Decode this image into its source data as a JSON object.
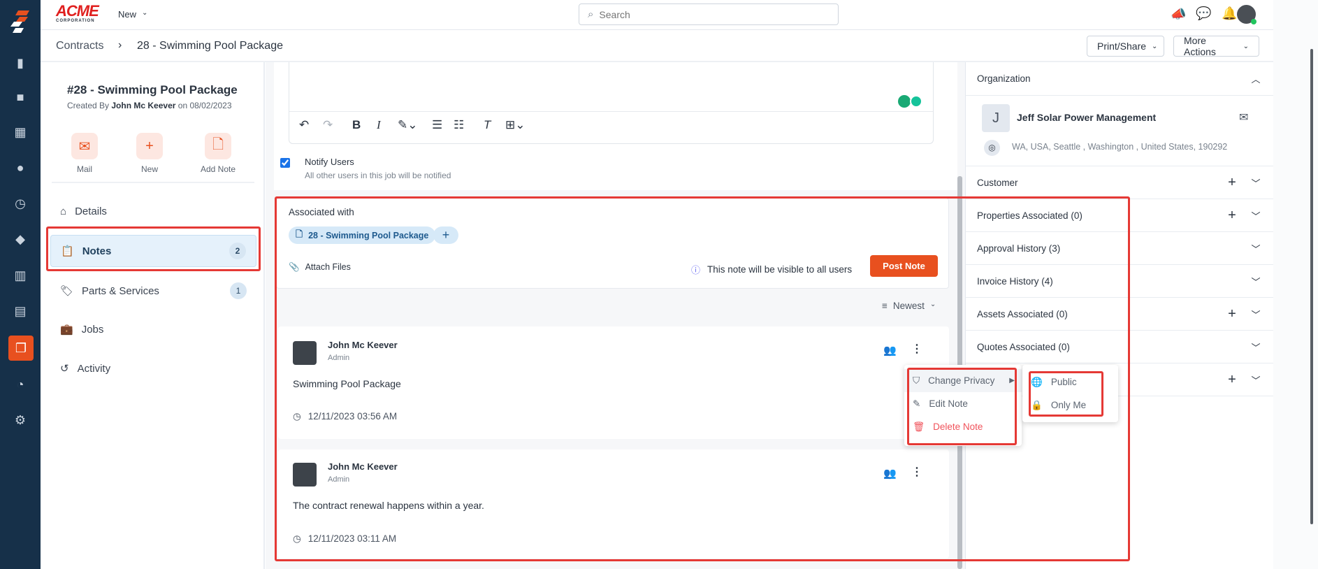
{
  "header": {
    "brand": "ACME",
    "brand_sub": "CORPORATION",
    "new_label": "New",
    "search_placeholder": "Search"
  },
  "breadcrumb": {
    "root": "Contracts",
    "current": "28 - Swimming Pool Package"
  },
  "actions": {
    "print_share": "Print/Share",
    "more_actions": "More Actions"
  },
  "record": {
    "title": "#28 - Swimming Pool Package",
    "created_prefix": "Created By",
    "created_by": "John Mc Keever",
    "created_on": "on 08/02/2023"
  },
  "quick_actions": [
    {
      "label": "Mail"
    },
    {
      "label": "New"
    },
    {
      "label": "Add Note"
    }
  ],
  "nav": [
    {
      "label": "Details"
    },
    {
      "label": "Notes",
      "count": "2"
    },
    {
      "label": "Parts & Services",
      "count": "1"
    },
    {
      "label": "Jobs"
    },
    {
      "label": "Activity"
    }
  ],
  "editor": {
    "notify_label": "Notify Users",
    "notify_hint": "All other users in this job will be notified",
    "notify_checked": true
  },
  "composer": {
    "associated_label": "Associated with",
    "chip": "28 - Swimming Pool Package",
    "attach": "Attach Files",
    "visibility": "This note will be visible to all users",
    "post": "Post Note"
  },
  "sort": {
    "label": "Newest"
  },
  "notes": [
    {
      "author": "John Mc Keever",
      "role": "Admin",
      "text": "Swimming Pool Package",
      "time": "12/11/2023 03:56 AM"
    },
    {
      "author": "John Mc Keever",
      "role": "Admin",
      "text": "The contract renewal happens within a year.",
      "time": "12/11/2023 03:11 AM"
    }
  ],
  "menu": {
    "change_privacy": "Change Privacy",
    "edit": "Edit Note",
    "delete": "Delete Note"
  },
  "submenu": {
    "public": "Public",
    "only_me": "Only Me"
  },
  "right": {
    "org_header": "Organization",
    "org_initial": "J",
    "org_name": "Jeff Solar Power Management",
    "org_address": "WA, USA, Seattle , Washington , United States, 190292",
    "sections": [
      "Customer",
      "Properties Associated (0)",
      "Approval History (3)",
      "Invoice History (4)",
      "Assets Associated (0)",
      "Quotes Associated (0)",
      ""
    ]
  },
  "colors": {
    "accent": "#e8501f",
    "rail": "#163049",
    "highlight": "#e53935"
  }
}
